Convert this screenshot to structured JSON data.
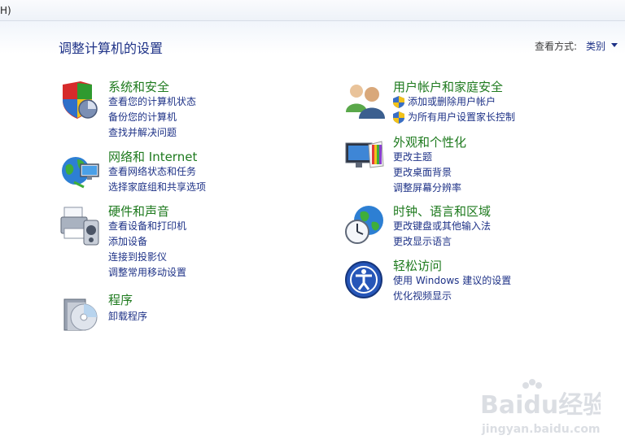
{
  "menubar": {
    "fragment": "H)"
  },
  "page_title": "调整计算机的设置",
  "view_by": {
    "label": "查看方式:",
    "value": "类别"
  },
  "categories": {
    "system": {
      "title": "系统和安全",
      "links": [
        "查看您的计算机状态",
        "备份您的计算机",
        "查找并解决问题"
      ]
    },
    "network": {
      "title": "网络和 Internet",
      "links": [
        "查看网络状态和任务",
        "选择家庭组和共享选项"
      ]
    },
    "hardware": {
      "title": "硬件和声音",
      "links": [
        "查看设备和打印机",
        "添加设备",
        "连接到投影仪",
        "调整常用移动设置"
      ]
    },
    "programs": {
      "title": "程序",
      "links": [
        "卸载程序"
      ]
    },
    "users": {
      "title": "用户帐户和家庭安全",
      "links": [
        "添加或删除用户帐户",
        "为所有用户设置家长控制"
      ]
    },
    "appearance": {
      "title": "外观和个性化",
      "links": [
        "更改主题",
        "更改桌面背景",
        "调整屏幕分辨率"
      ]
    },
    "clock": {
      "title": "时钟、语言和区域",
      "links": [
        "更改键盘或其他输入法",
        "更改显示语言"
      ]
    },
    "ease": {
      "title": "轻松访问",
      "links": [
        "使用 Windows 建议的设置",
        "优化视频显示"
      ]
    }
  },
  "watermark": {
    "brand": "Baidu经验",
    "url": "jingyan.baidu.com"
  }
}
